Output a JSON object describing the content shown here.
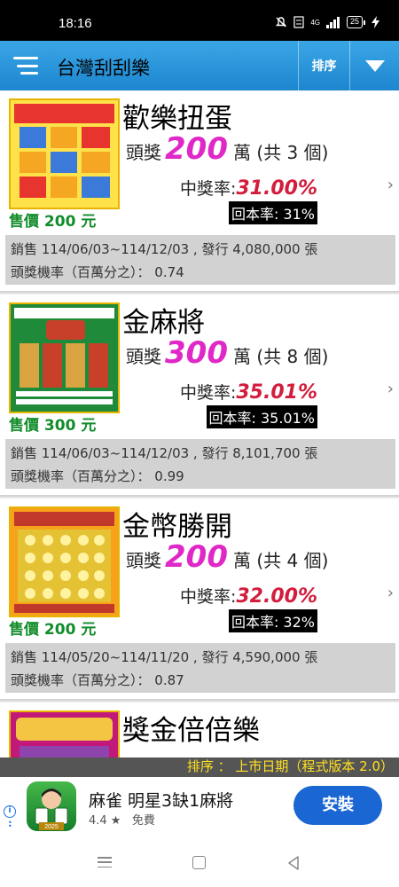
{
  "status_bar": {
    "time": "18:16",
    "battery": "25",
    "signal_label": "4G"
  },
  "app_bar": {
    "title": "台灣刮刮樂",
    "sort_label": "排序"
  },
  "items": [
    {
      "name": "歡樂扭蛋",
      "prize_prefix": "頭獎",
      "prize_amount": "200",
      "prize_suffix": "萬 (共 3 個)",
      "win_label": "中獎率:",
      "win_rate": "31.00%",
      "return_rate": "回本率: 31%",
      "price": "售價 200 元",
      "sales": "銷售 114/06/03~114/12/03 , 發行 4,080,000 張",
      "odds": "頭獎機率（百萬分之）： 0.74",
      "ticket_colors": [
        "#ffe14a",
        "#e8342f",
        "#3b7ad8",
        "#f5a623"
      ]
    },
    {
      "name": "金麻將",
      "prize_prefix": "頭獎",
      "prize_amount": "300",
      "prize_suffix": "萬 (共 8 個)",
      "win_label": "中獎率:",
      "win_rate": "35.01%",
      "return_rate": "回本率: 35.01%",
      "price": "售價 300 元",
      "sales": "銷售 114/06/03~114/12/03 , 發行 8,101,700 張",
      "odds": "頭獎機率（百萬分之）： 0.99",
      "ticket_colors": [
        "#1f8a3a",
        "#c8402a",
        "#d9a441",
        "#ffffff"
      ]
    },
    {
      "name": "金幣勝開",
      "prize_prefix": "頭獎",
      "prize_amount": "200",
      "prize_suffix": "萬 (共 4 個)",
      "win_label": "中獎率:",
      "win_rate": "32.00%",
      "return_rate": "回本率: 32%",
      "price": "售價 200 元",
      "sales": "銷售 114/05/20~114/11/20 , 發行 4,590,000 張",
      "odds": "頭獎機率（百萬分之）： 0.87",
      "ticket_colors": [
        "#f7a21b",
        "#e4c233",
        "#c0392b",
        "#fff2a0"
      ]
    },
    {
      "name": "獎金倍倍樂",
      "ticket_colors": [
        "#c2187a",
        "#f4c542",
        "#8e44ad",
        "#ffe680"
      ]
    }
  ],
  "sort_banner": "排序 ： 上市日期（程式版本 2.0）",
  "ad": {
    "title": "麻雀 明星3缺1麻將",
    "rating": "4.4 ★",
    "price": "免費",
    "install_label": "安裝",
    "icon_year": "2025"
  }
}
